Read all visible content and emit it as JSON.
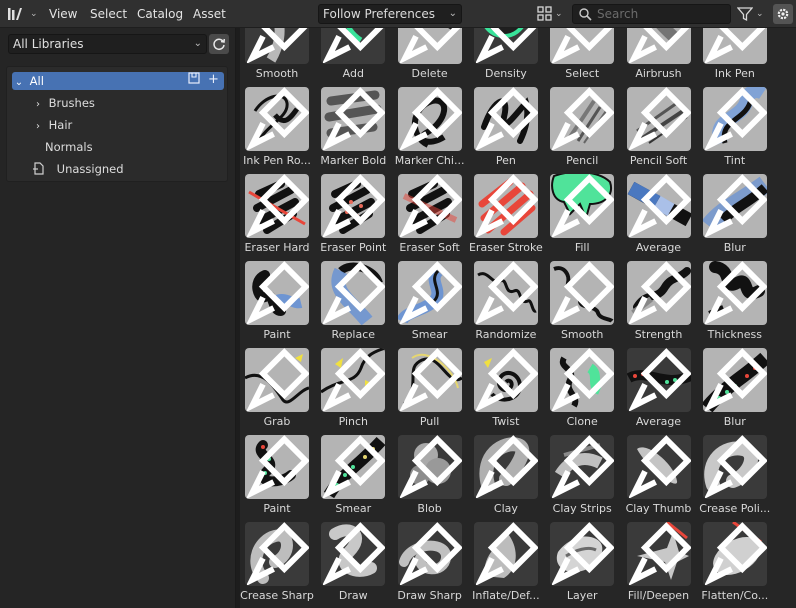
{
  "header": {
    "menus": [
      "View",
      "Select",
      "Catalog",
      "Asset"
    ],
    "import_method": "Follow Preferences",
    "search_placeholder": "Search"
  },
  "sidebar": {
    "library": "All Libraries",
    "catalog_tree": [
      {
        "label": "All",
        "expanded": true,
        "active": true
      },
      {
        "label": "Brushes",
        "expandable": true
      },
      {
        "label": "Hair",
        "expandable": true
      },
      {
        "label": "Normals"
      },
      {
        "label": "Unassigned"
      }
    ]
  },
  "colors": {
    "accent": "#4772b3",
    "header_bg": "#303030",
    "panel_bg": "#252525",
    "thumb_bg": "#b4b4b4"
  },
  "assets": [
    {
      "label": "Smooth",
      "thumb": "dark-stroke",
      "dark": true
    },
    {
      "label": "Add",
      "thumb": "green-strokes",
      "dark": true
    },
    {
      "label": "Delete",
      "thumb": "red-line",
      "dark": false
    },
    {
      "label": "Density",
      "thumb": "density-circle",
      "dark": true
    },
    {
      "label": "Select",
      "thumb": "select-circle",
      "dark": false
    },
    {
      "label": "Airbrush",
      "thumb": "airbrush",
      "dark": false
    },
    {
      "label": "Ink Pen",
      "thumb": "ink-pen",
      "dark": false
    },
    {
      "label": "Ink Pen Ro...",
      "thumb": "ink-pen-rough",
      "dark": false
    },
    {
      "label": "Marker Bold",
      "thumb": "marker-bold",
      "dark": false
    },
    {
      "label": "Marker Chi...",
      "thumb": "marker-chisel",
      "dark": false
    },
    {
      "label": "Pen",
      "thumb": "pen",
      "dark": false
    },
    {
      "label": "Pencil",
      "thumb": "pencil",
      "dark": false
    },
    {
      "label": "Pencil Soft",
      "thumb": "pencil-soft",
      "dark": false
    },
    {
      "label": "Tint",
      "thumb": "tint",
      "dark": false
    },
    {
      "label": "Eraser Hard",
      "thumb": "eraser-hard",
      "dark": false
    },
    {
      "label": "Eraser Point",
      "thumb": "eraser-point",
      "dark": false
    },
    {
      "label": "Eraser Soft",
      "thumb": "eraser-soft",
      "dark": false
    },
    {
      "label": "Eraser Stroke",
      "thumb": "eraser-stroke",
      "dark": false
    },
    {
      "label": "Fill",
      "thumb": "fill",
      "dark": false
    },
    {
      "label": "Average",
      "thumb": "average-band",
      "dark": false
    },
    {
      "label": "Blur",
      "thumb": "blur-band",
      "dark": false
    },
    {
      "label": "Paint",
      "thumb": "paint",
      "dark": false
    },
    {
      "label": "Replace",
      "thumb": "replace",
      "dark": false
    },
    {
      "label": "Smear",
      "thumb": "smear",
      "dark": false
    },
    {
      "label": "Randomize",
      "thumb": "randomize",
      "dark": false
    },
    {
      "label": "Smooth",
      "thumb": "smooth-squiggle",
      "dark": false
    },
    {
      "label": "Strength",
      "thumb": "strength",
      "dark": false
    },
    {
      "label": "Thickness",
      "thumb": "thickness",
      "dark": false
    },
    {
      "label": "Grab",
      "thumb": "grab",
      "dark": false
    },
    {
      "label": "Pinch",
      "thumb": "pinch",
      "dark": false
    },
    {
      "label": "Pull",
      "thumb": "pull",
      "dark": false
    },
    {
      "label": "Twist",
      "thumb": "twist",
      "dark": false
    },
    {
      "label": "Clone",
      "thumb": "clone",
      "dark": false
    },
    {
      "label": "Average",
      "thumb": "average-dots",
      "dark": true
    },
    {
      "label": "Blur",
      "thumb": "blur-dots",
      "dark": false
    },
    {
      "label": "Paint",
      "thumb": "paint-dots",
      "dark": false
    },
    {
      "label": "Smear",
      "thumb": "smear-dots",
      "dark": false
    },
    {
      "label": "Blob",
      "thumb": "sculpt-blob",
      "dark": true
    },
    {
      "label": "Clay",
      "thumb": "sculpt-clay",
      "dark": true
    },
    {
      "label": "Clay Strips",
      "thumb": "sculpt-strips",
      "dark": true
    },
    {
      "label": "Clay Thumb",
      "thumb": "sculpt-thumb",
      "dark": true
    },
    {
      "label": "Crease Poli...",
      "thumb": "sculpt-crease",
      "dark": true
    },
    {
      "label": "Crease Sharp",
      "thumb": "sculpt-crease2",
      "dark": true
    },
    {
      "label": "Draw",
      "thumb": "sculpt-draw",
      "dark": true
    },
    {
      "label": "Draw Sharp",
      "thumb": "sculpt-drawsharp",
      "dark": true
    },
    {
      "label": "Inflate/Def...",
      "thumb": "sculpt-inflate",
      "dark": true
    },
    {
      "label": "Layer",
      "thumb": "sculpt-layer",
      "dark": true
    },
    {
      "label": "Fill/Deepen",
      "thumb": "sculpt-fill",
      "dark": true
    },
    {
      "label": "Flatten/Co...",
      "thumb": "sculpt-flatten",
      "dark": true
    }
  ]
}
